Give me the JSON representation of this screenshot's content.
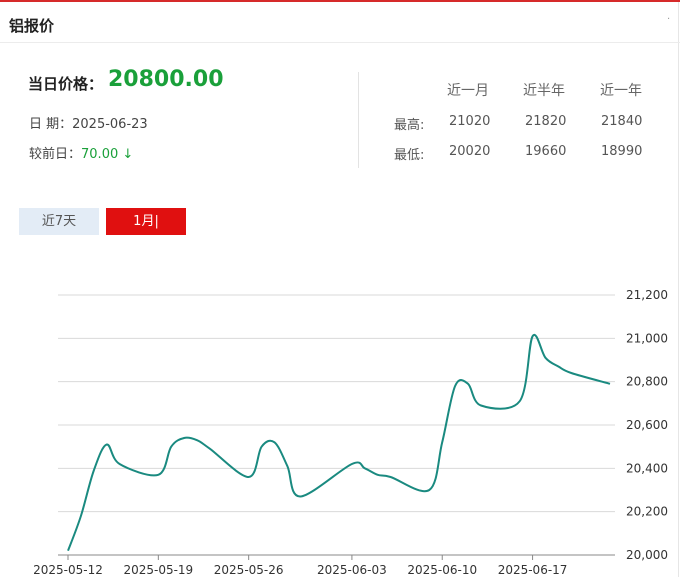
{
  "header": {
    "title": "铝报价",
    "dot": "·"
  },
  "summary": {
    "price_label": "当日价格：",
    "price_value": "20800.00",
    "date_label": "日  期：",
    "date_value": "2025-06-23",
    "change_label": "较前日：",
    "change_value": "70.00 ↓"
  },
  "stats": {
    "headers": [
      "近一月",
      "近半年",
      "近一年"
    ],
    "rows": [
      {
        "label": "最高:",
        "values": [
          "21020",
          "21820",
          "21840"
        ]
      },
      {
        "label": "最低:",
        "values": [
          "20020",
          "19660",
          "18990"
        ]
      }
    ]
  },
  "tabs": [
    {
      "label": "近7天",
      "active": false
    },
    {
      "label": "1月|",
      "active": true
    }
  ],
  "colors": {
    "accent_red": "#e01010",
    "up_green": "#1aa03a",
    "line": "#1a8a80",
    "grid": "#d9d9d9"
  },
  "chart_data": {
    "type": "line",
    "title": "",
    "xlabel": "",
    "ylabel": "",
    "ylim": [
      20000,
      21200
    ],
    "yticks": [
      "20,000",
      "20,200",
      "20,400",
      "20,600",
      "20,800",
      "21,000",
      "21,200"
    ],
    "ytick_values": [
      20000,
      20200,
      20400,
      20600,
      20800,
      21000,
      21200
    ],
    "xtick_labels": [
      "2025-05-12",
      "2025-05-19",
      "2025-05-26",
      "2025-06-03",
      "2025-06-10",
      "2025-06-17"
    ],
    "grid": true,
    "series": [
      {
        "name": "",
        "x": [
          "2025-05-12",
          "2025-05-13",
          "2025-05-14",
          "2025-05-15",
          "2025-05-16",
          "2025-05-19",
          "2025-05-20",
          "2025-05-21",
          "2025-05-22",
          "2025-05-23",
          "2025-05-26",
          "2025-05-27",
          "2025-05-28",
          "2025-05-29",
          "2025-05-30",
          "2025-06-03",
          "2025-06-04",
          "2025-06-05",
          "2025-06-06",
          "2025-06-09",
          "2025-06-10",
          "2025-06-11",
          "2025-06-12",
          "2025-06-13",
          "2025-06-16",
          "2025-06-17",
          "2025-06-18",
          "2025-06-19",
          "2025-06-20",
          "2025-06-23"
        ],
        "values": [
          20020,
          20180,
          20390,
          20510,
          20420,
          20370,
          20500,
          20540,
          20530,
          20490,
          20360,
          20500,
          20520,
          20410,
          20270,
          20420,
          20400,
          20370,
          20360,
          20300,
          20520,
          20780,
          20790,
          20690,
          20710,
          21010,
          20910,
          20870,
          20840,
          20790
        ]
      }
    ]
  }
}
